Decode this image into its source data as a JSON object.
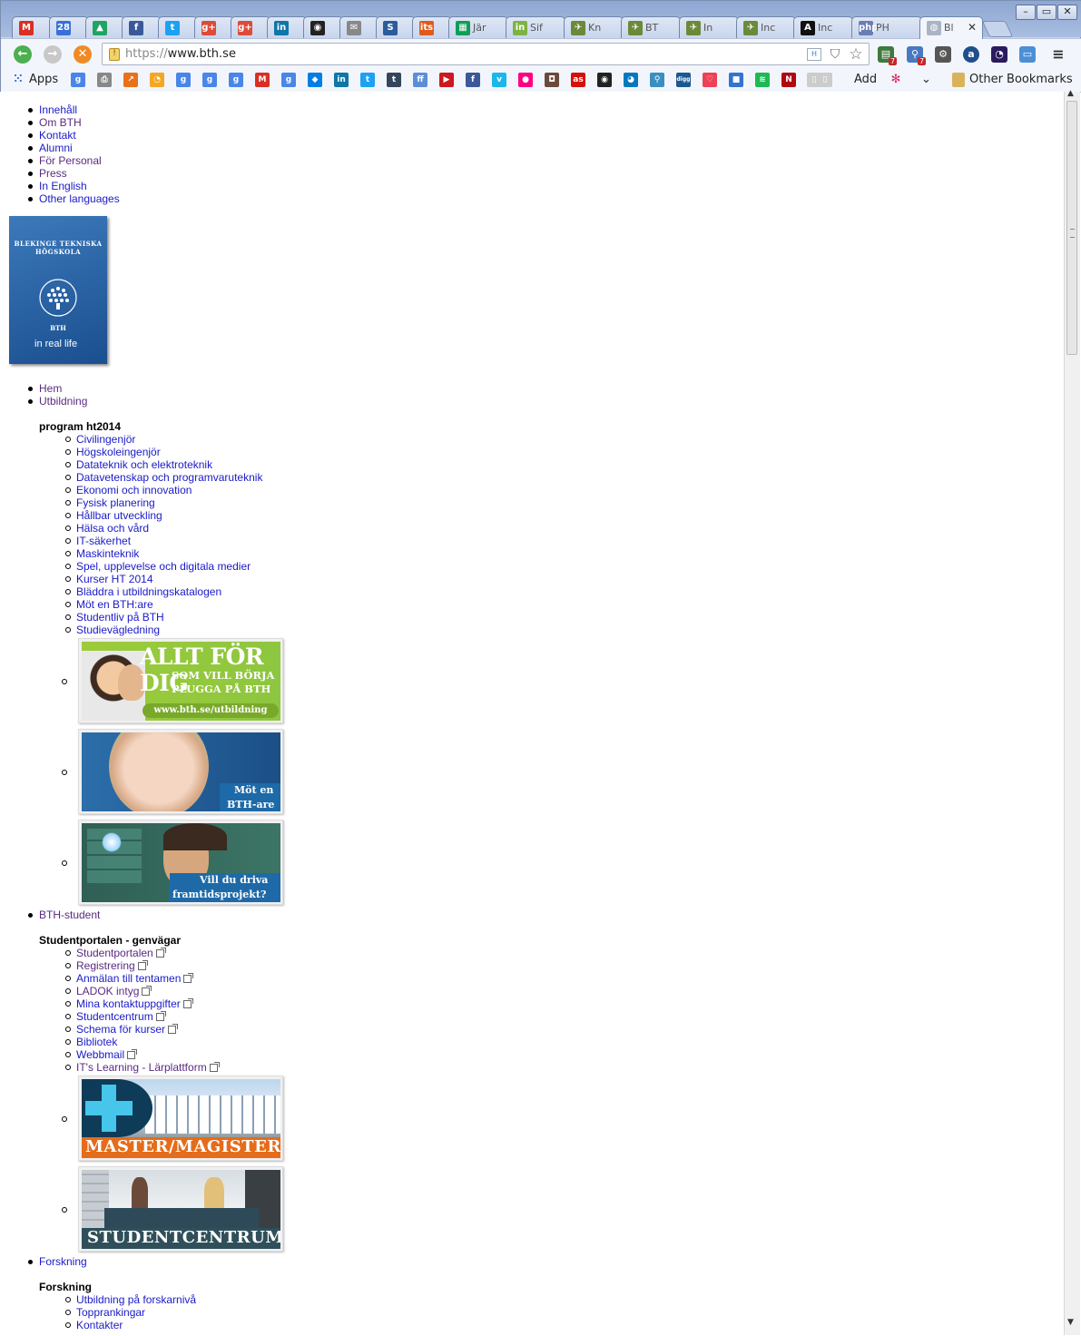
{
  "browser": {
    "tabs": [
      {
        "title": "",
        "icon": "gmail-icon",
        "color": "#d93025",
        "glyph": "M"
      },
      {
        "title": "",
        "icon": "calendar-icon",
        "color": "#3b6fd8",
        "glyph": "28"
      },
      {
        "title": "",
        "icon": "drive-icon",
        "color": "#1fa463",
        "glyph": "▲"
      },
      {
        "title": "",
        "icon": "facebook-icon",
        "color": "#3b5998",
        "glyph": "f"
      },
      {
        "title": "",
        "icon": "twitter-icon",
        "color": "#1da1f2",
        "glyph": "t"
      },
      {
        "title": "",
        "icon": "google-plus-icon",
        "color": "#dd4b39",
        "glyph": "g+"
      },
      {
        "title": "",
        "icon": "google-plus-icon",
        "color": "#dd4b39",
        "glyph": "g+"
      },
      {
        "title": "",
        "icon": "linkedin-icon",
        "color": "#0e76a8",
        "glyph": "in"
      },
      {
        "title": "",
        "icon": "github-icon",
        "color": "#222222",
        "glyph": "◉"
      },
      {
        "title": "",
        "icon": "mail-icon",
        "color": "#888888",
        "glyph": "✉"
      },
      {
        "title": "",
        "icon": "s-app-icon",
        "color": "#2a5d9a",
        "glyph": "S"
      },
      {
        "title": "",
        "icon": "its-icon",
        "color": "#e05a1a",
        "glyph": "its"
      },
      {
        "title": "Jär",
        "icon": "sheets-icon",
        "color": "#0f9d58",
        "glyph": "▦"
      },
      {
        "title": "Sif",
        "icon": "invision-icon",
        "color": "#7cb342",
        "glyph": "in"
      },
      {
        "title": "Kn",
        "icon": "bird-icon",
        "color": "#6a8a3a",
        "glyph": "✈"
      },
      {
        "title": "BT",
        "icon": "bird-icon",
        "color": "#6a8a3a",
        "glyph": "✈"
      },
      {
        "title": "In",
        "icon": "bird-icon",
        "color": "#6a8a3a",
        "glyph": "✈"
      },
      {
        "title": "Inc",
        "icon": "bird-icon",
        "color": "#6a8a3a",
        "glyph": "✈"
      },
      {
        "title": "Inc",
        "icon": "a-serif-icon",
        "color": "#111111",
        "glyph": "A"
      },
      {
        "title": "PH",
        "icon": "php-icon",
        "color": "#6a7eb5",
        "glyph": "php"
      },
      {
        "title": "Bl",
        "icon": "globe-icon",
        "color": "#aab4c4",
        "glyph": "◍",
        "active": true
      }
    ],
    "window_controls": {
      "minimize": "–",
      "maximize": "▭",
      "close": "✕"
    },
    "url_scheme": "https://",
    "url_host": "www.bth.se",
    "toolbar_icons": [
      "html-icon",
      "shield-icon",
      "star-icon"
    ],
    "extension_badges": {
      "first": "7",
      "second": "7"
    },
    "bookmarks": {
      "apps_label": "Apps",
      "add_label": "Add",
      "other_label": "Other Bookmarks",
      "icons": [
        {
          "name": "google-icon",
          "color": "#4a86e8",
          "glyph": "g"
        },
        {
          "name": "print-icon",
          "color": "#888888",
          "glyph": "⎙"
        },
        {
          "name": "chart-icon",
          "color": "#e8711c",
          "glyph": "↗"
        },
        {
          "name": "rss-icon",
          "color": "#f5a623",
          "glyph": "◔"
        },
        {
          "name": "google-icon",
          "color": "#4a86e8",
          "glyph": "g"
        },
        {
          "name": "google-icon",
          "color": "#4a86e8",
          "glyph": "g"
        },
        {
          "name": "google-icon",
          "color": "#4a86e8",
          "glyph": "g"
        },
        {
          "name": "gmail-icon",
          "color": "#d93025",
          "glyph": "M"
        },
        {
          "name": "google-icon",
          "color": "#4a86e8",
          "glyph": "g"
        },
        {
          "name": "dropbox-icon",
          "color": "#007ee5",
          "glyph": "◆"
        },
        {
          "name": "linkedin-icon",
          "color": "#0e76a8",
          "glyph": "in"
        },
        {
          "name": "twitter-icon",
          "color": "#1da1f2",
          "glyph": "t"
        },
        {
          "name": "tumblr-icon",
          "color": "#35465c",
          "glyph": "t"
        },
        {
          "name": "feedly-icon",
          "color": "#5c8ed8",
          "glyph": "ff"
        },
        {
          "name": "youtube-icon",
          "color": "#cc181e",
          "glyph": "▶"
        },
        {
          "name": "facebook-icon",
          "color": "#3b5998",
          "glyph": "f"
        },
        {
          "name": "vimeo-icon",
          "color": "#1ab7ea",
          "glyph": "v"
        },
        {
          "name": "flickr-icon",
          "color": "#ff0084",
          "glyph": "●"
        },
        {
          "name": "instagram-icon",
          "color": "#6b4a3a",
          "glyph": "◘"
        },
        {
          "name": "lastfm-icon",
          "color": "#d51007",
          "glyph": "as"
        },
        {
          "name": "github-icon",
          "color": "#222222",
          "glyph": "◉"
        },
        {
          "name": "drupal-icon",
          "color": "#0678be",
          "glyph": "◕"
        },
        {
          "name": "chart-icon",
          "color": "#3a8fc1",
          "glyph": "⚲"
        },
        {
          "name": "digg-icon",
          "color": "#1b5891",
          "glyph": "digg"
        },
        {
          "name": "pocket-icon",
          "color": "#ee4056",
          "glyph": "♡"
        },
        {
          "name": "delicious-icon",
          "color": "#3274d1",
          "glyph": "■"
        },
        {
          "name": "spotify-icon",
          "color": "#1db954",
          "glyph": "≋"
        },
        {
          "name": "netflix-icon",
          "color": "#b20710",
          "glyph": "N"
        },
        {
          "name": "page-icon",
          "color": "#cccccc",
          "glyph": "▯"
        },
        {
          "name": "page-icon",
          "color": "#cccccc",
          "glyph": "▯"
        }
      ]
    }
  },
  "page": {
    "top_nav": [
      "Innehåll",
      "Om BTH",
      "Kontakt",
      "Alumni",
      "För Personal",
      "Press",
      "In English",
      "Other languages"
    ],
    "logo": {
      "ring_text": "BLEKINGE TEKNISKA HÖGSKOLA",
      "abbr": "BTH",
      "tagline": "in real life"
    },
    "main_nav": {
      "item1": "Hem",
      "item2": "Utbildning",
      "program_header": "program ht2014",
      "program_links": [
        "Civilingenjör",
        "Högskoleingenjör",
        "Datateknik och elektroteknik",
        "Datavetenskap och programvaruteknik",
        "Ekonomi och innovation",
        "Fysisk planering",
        "Hållbar utveckling",
        "Hälsa och vård",
        "IT-säkerhet",
        "Maskinteknik",
        "Spel, upplevelse och digitala medier",
        "Kurser HT 2014",
        "Bläddra i utbildningskatalogen",
        "Möt en BTH:are",
        "Studentliv på BTH",
        "Studievägledning"
      ],
      "banners1": {
        "b1_line1": "ALLT FÖR DIG",
        "b1_line2": "SOM VILL BÖRJA",
        "b1_line3": "PLUGGA PÅ BTH",
        "b1_url": "www.bth.se/utbildning",
        "b2_line1": "Möt en",
        "b2_line2": "BTH-are",
        "b3_line1": "Vill du driva",
        "b3_line2": "framtidsprojekt?"
      },
      "item3": "BTH-student",
      "student_header": "Studentportalen - genvägar",
      "student_links": [
        {
          "label": "Studentportalen",
          "external": true
        },
        {
          "label": "Registrering",
          "external": true
        },
        {
          "label": "Anmälan till tentamen",
          "external": true
        },
        {
          "label": "LADOK intyg",
          "external": true
        },
        {
          "label": "Mina kontaktuppgifter",
          "external": true
        },
        {
          "label": "Studentcentrum",
          "external": true
        },
        {
          "label": "Schema för kurser",
          "external": true
        },
        {
          "label": "Bibliotek",
          "external": false
        },
        {
          "label": "Webbmail",
          "external": true
        },
        {
          "label": "IT's Learning - Lärplattform",
          "external": true
        }
      ],
      "banners2": {
        "b4_text": "MASTER/MAGISTER",
        "b5_text": "STUDENTCENTRUM"
      },
      "item4": "Forskning",
      "research_header": "Forskning",
      "research_links": [
        "Utbildning på forskarnivå",
        "Topprankingar",
        "Kontakter"
      ]
    }
  }
}
